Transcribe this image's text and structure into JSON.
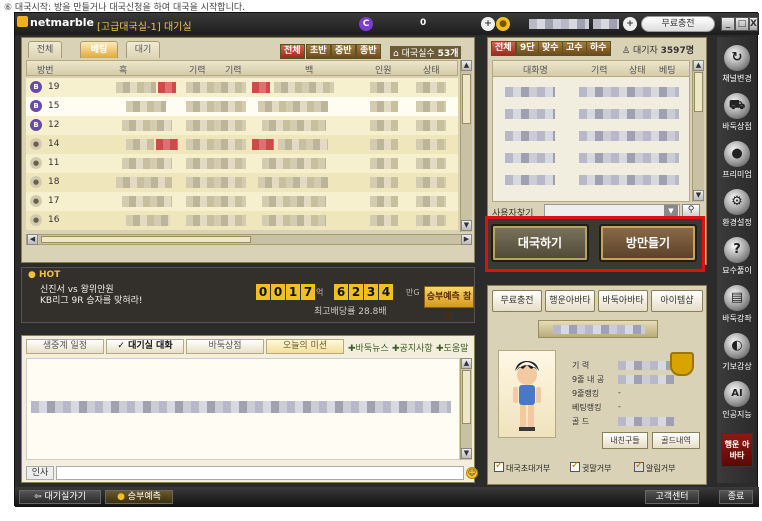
{
  "caption": "⑥ 대국시작: 방을 만들거나 대국신청을 하여 대국을 시작합니다.",
  "titlebar": {
    "logo": "netmarble",
    "room_title": "[고급대국실-1] 대기실",
    "top_value": "0",
    "charge_label": "무료충전",
    "minimize": "_",
    "maximize": "□",
    "close": "X"
  },
  "left": {
    "tabs": [
      "전체",
      "베팅",
      "대기"
    ],
    "active_tab": "베팅",
    "filters": [
      "전체",
      "초반",
      "중반",
      "종반"
    ],
    "active_filter": "전체",
    "real_time_label": "대국실수",
    "real_time_count": "53개",
    "columns": [
      "방번",
      "흑",
      "기력",
      "기력",
      "백",
      "인원",
      "상태"
    ],
    "rows": [
      {
        "no": "19",
        "badge": "purple"
      },
      {
        "no": "15",
        "badge": "purple"
      },
      {
        "no": "12",
        "badge": "purple"
      },
      {
        "no": "14",
        "badge": "gray"
      },
      {
        "no": "11",
        "badge": "gray"
      },
      {
        "no": "18",
        "badge": "gray"
      },
      {
        "no": "17",
        "badge": "gray"
      },
      {
        "no": "16",
        "badge": "gray"
      }
    ]
  },
  "hot": {
    "label": "HOT",
    "news_line1": "신진서 vs 왕위안원",
    "news_line2": "KB리그 9R 승자를 맞혀라!",
    "digits_a": [
      "0",
      "0",
      "1",
      "7"
    ],
    "unit_a": "억",
    "digits_b": [
      "6",
      "2",
      "3",
      "4"
    ],
    "unit_b": "만G",
    "max_payout": "최고배당률 28.8배",
    "bet_button": "승부예측 참여"
  },
  "chat": {
    "tabs": [
      "생중계 일정",
      "대기실 대화",
      "바둑상점",
      "오늘의 미션"
    ],
    "links": [
      "바둑뉴스",
      "공지사항",
      "도움말"
    ],
    "input_label": "인사"
  },
  "right": {
    "filters": [
      "전체",
      "9단",
      "맞수",
      "고수",
      "하수"
    ],
    "waiting_label": "대기자",
    "waiting_count": "3597명",
    "columns": [
      "대화명",
      "기력",
      "상태",
      "베팅"
    ],
    "search_label": "사용자찾기"
  },
  "actions": {
    "play": "대국하기",
    "make_room": "방만들기"
  },
  "profile": {
    "buttons": [
      "무료충전",
      "행운아바타",
      "바둑아바타",
      "아이템샵"
    ],
    "stats": [
      {
        "label": "기       력",
        "value": ""
      },
      {
        "label": "9줄 내 공",
        "value": ""
      },
      {
        "label": "9줄랭킹",
        "value": "-"
      },
      {
        "label": "베팅랭킹",
        "value": "-"
      },
      {
        "label": "골       드",
        "value": ""
      }
    ],
    "friends_btn": "내친구들",
    "gold_btn": "골드내역",
    "checks": [
      "대국초대거부",
      "귓말거부",
      "알림거부"
    ]
  },
  "sidebar": {
    "items": [
      {
        "label": "채널변경",
        "icon": "refresh-icon",
        "glyph": "↻"
      },
      {
        "label": "바둑상점",
        "icon": "cart-icon",
        "glyph": "⛟"
      },
      {
        "label": "프리미엄",
        "icon": "premium-icon",
        "glyph": "●"
      },
      {
        "label": "환경설정",
        "icon": "gear-icon",
        "glyph": "⚙"
      },
      {
        "label": "묘수풀이",
        "icon": "question-icon",
        "glyph": "?"
      },
      {
        "label": "바둑강좌",
        "icon": "book-icon",
        "glyph": "▤"
      },
      {
        "label": "기보감상",
        "icon": "stones-icon",
        "glyph": "◐"
      },
      {
        "label": "인공지능",
        "icon": "ai-icon",
        "glyph": "AI"
      }
    ],
    "special": "행운 아바타"
  },
  "bottom": {
    "back": "대기실가기",
    "predict": "승부예측",
    "support": "고객센터",
    "exit": "종료"
  }
}
